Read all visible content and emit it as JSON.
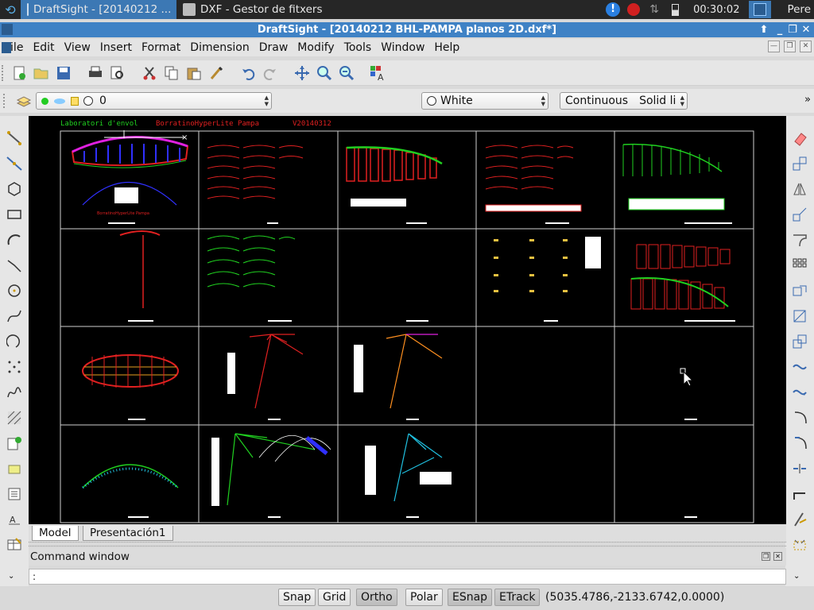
{
  "taskbar": {
    "tasks": [
      {
        "label": "DraftSight - [20140212 ..."
      },
      {
        "label": "DXF - Gestor de fitxers"
      }
    ],
    "clock": "00:30:02",
    "user": "Pere"
  },
  "window": {
    "title": "DraftSight - [20140212 BHL-PAMPA planos 2D.dxf*]"
  },
  "menu": [
    "File",
    "Edit",
    "View",
    "Insert",
    "Format",
    "Dimension",
    "Draw",
    "Modify",
    "Tools",
    "Window",
    "Help"
  ],
  "properties": {
    "layer": "0",
    "color": "White",
    "linetype_name": "Continuous",
    "linetype_desc": "Solid li"
  },
  "drawing": {
    "header_left": "Laboratori d'envol",
    "header_mid": "BorratinoHyperLite Pampa",
    "header_right": "V20140312",
    "cell_label": "BorratinoHyperLite Pampa"
  },
  "tabs": [
    "Model",
    "Presentación1"
  ],
  "command": {
    "header": "Command window",
    "prompt": ":"
  },
  "status": {
    "buttons": [
      "Snap",
      "Grid",
      "Ortho",
      "Polar",
      "ESnap",
      "ETrack"
    ],
    "active": [
      "Ortho",
      "ESnap",
      "ETrack"
    ],
    "coordinates": "(5035.4786,-2133.6742,0.0000)"
  },
  "colors": {
    "titlebar": "#3f82c5",
    "taskbar": "#262626",
    "canvas_bg": "#000000",
    "red": "#e02020",
    "green": "#20d020",
    "cyan": "#20c0e0",
    "orange": "#ff9020",
    "blue": "#3030ff"
  }
}
